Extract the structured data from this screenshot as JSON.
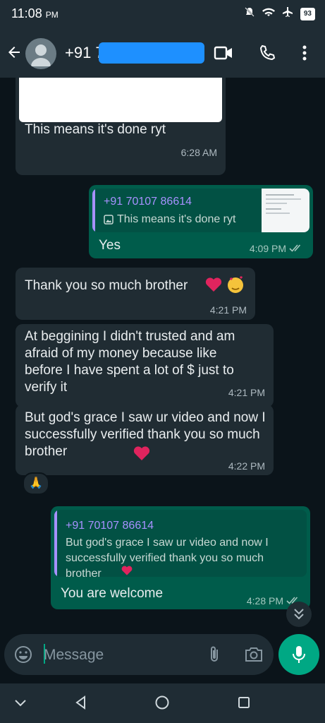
{
  "status": {
    "time": "11:08",
    "ampm": "PM",
    "battery": "93"
  },
  "header": {
    "contact": "+91 7"
  },
  "messages": [
    {
      "text": "This means it's done ryt",
      "time": "6:28 AM"
    },
    {
      "quote_name": "+91 70107 86614",
      "quote_text": "This means it's done ryt",
      "text": "Yes",
      "time": "4:09 PM"
    },
    {
      "text": "Thank you so much brother",
      "time": "4:21 PM"
    },
    {
      "text": "At beggining I didn't trusted and am afraid of my money because like before I have spent a lot of $ just to verify it",
      "time": "4:21 PM"
    },
    {
      "text": "But god's grace I saw ur video and now I successfully verified thank you so much brother",
      "time": "4:22 PM"
    },
    {
      "quote_name": "+91 70107 86614",
      "quote_text": "But god's grace I saw ur video and now I successfully verified thank you so much brother",
      "text": "You are welcome",
      "time": "4:28 PM"
    }
  ],
  "reaction": "🙏",
  "input": {
    "placeholder": "Message"
  },
  "colors": {
    "accent": "#00a884",
    "incoming": "#202c33",
    "outgoing": "#005c4b",
    "background": "#0b141a"
  }
}
